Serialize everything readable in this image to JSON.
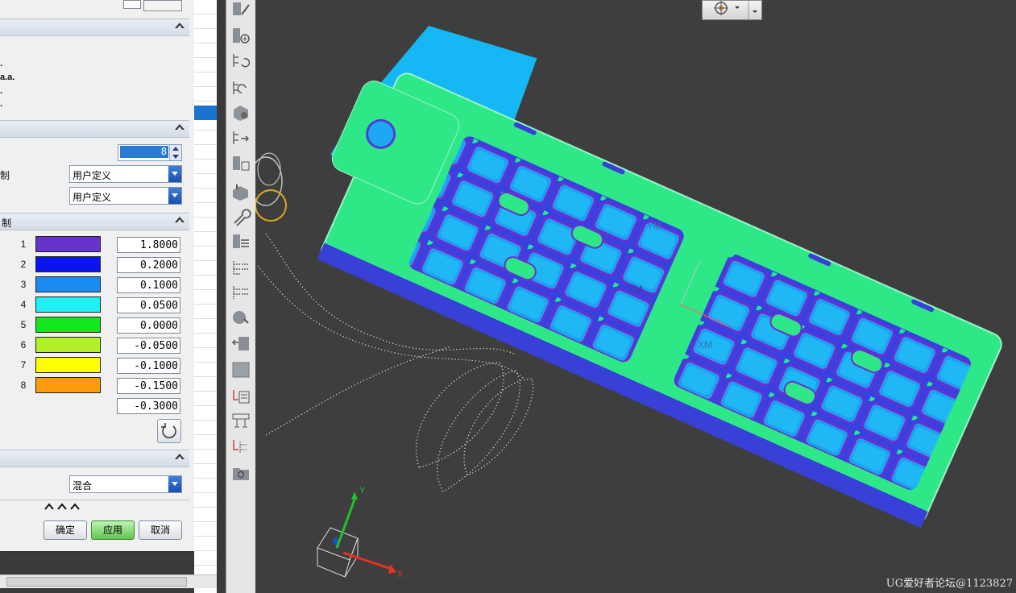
{
  "dialog": {
    "info_lines": [
      ".",
      "a.a.",
      ".",
      "."
    ],
    "count_value": "8",
    "label_row1_suffix": "制",
    "select1": "用户定义",
    "select2": "用户定义",
    "section3_label": "制",
    "legend_rows": [
      {
        "index": "1",
        "color": "#6633cc",
        "value": "1.8000"
      },
      {
        "index": "2",
        "color": "#0a14f0",
        "value": "0.2000"
      },
      {
        "index": "3",
        "color": "#1a8cf0",
        "value": "0.1000"
      },
      {
        "index": "4",
        "color": "#1ff0f5",
        "value": "0.0500"
      },
      {
        "index": "5",
        "color": "#14e61e",
        "value": "0.0000"
      },
      {
        "index": "6",
        "color": "#b4f028",
        "value": "-0.0500"
      },
      {
        "index": "7",
        "color": "#ffff00",
        "value": "-0.1000"
      },
      {
        "index": "8",
        "color": "#ff9b0a",
        "value": "-0.1500"
      }
    ],
    "last_value": "-0.3000",
    "blend_select": "混合",
    "buttons": {
      "ok": "确定",
      "apply": "应用",
      "cancel": "取消"
    }
  },
  "viewport": {
    "axis_labels": {
      "ym": "YM",
      "zm": "ZM",
      "xm": "XM",
      "y": "Y",
      "x": "X"
    },
    "watermark": "UG爱好者论坛@1123827"
  }
}
